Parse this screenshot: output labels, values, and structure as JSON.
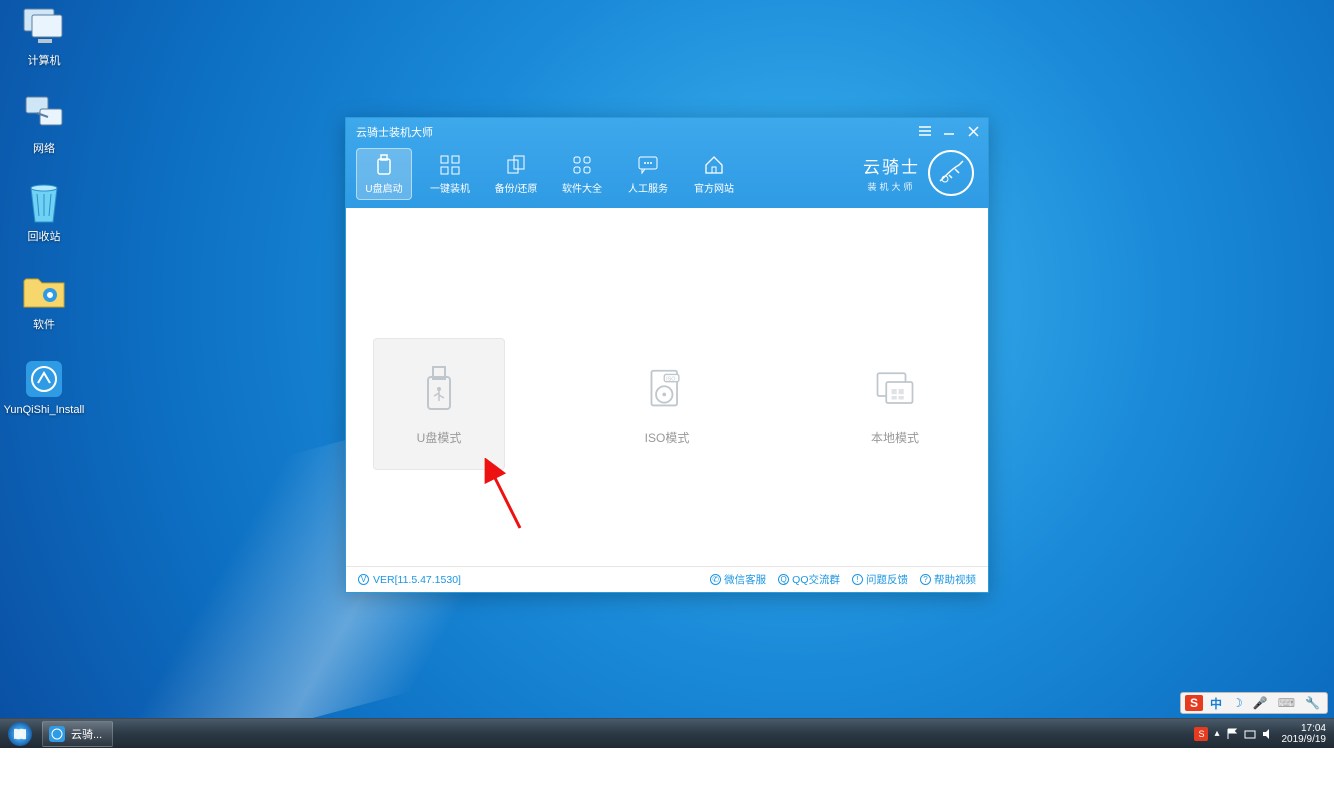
{
  "desktop": {
    "icons": [
      {
        "name": "computer",
        "label": "计算机"
      },
      {
        "name": "network",
        "label": "网络"
      },
      {
        "name": "recycle",
        "label": "回收站"
      },
      {
        "name": "software",
        "label": "软件"
      },
      {
        "name": "yunqishi",
        "label": "YunQiShi_Install"
      }
    ]
  },
  "app": {
    "title": "云骑士装机大师",
    "tabs": [
      {
        "id": "usb-boot",
        "label": "U盘启动",
        "active": true
      },
      {
        "id": "one-key-install",
        "label": "一键装机"
      },
      {
        "id": "backup-restore",
        "label": "备份/还原"
      },
      {
        "id": "software-daquan",
        "label": "软件大全"
      },
      {
        "id": "manual-service",
        "label": "人工服务"
      },
      {
        "id": "official-site",
        "label": "官方网站"
      }
    ],
    "brand": {
      "name": "云骑士",
      "sub": "装机大师"
    },
    "modes": [
      {
        "id": "usb-mode",
        "label": "U盘模式",
        "active": true
      },
      {
        "id": "iso-mode",
        "label": "ISO模式"
      },
      {
        "id": "local-mode",
        "label": "本地模式"
      }
    ],
    "version": "VER[11.5.47.1530]",
    "footerLinks": [
      {
        "id": "wechat-cs",
        "label": "微信客服"
      },
      {
        "id": "qq-group",
        "label": "QQ交流群"
      },
      {
        "id": "feedback",
        "label": "问题反馈"
      },
      {
        "id": "help-video",
        "label": "帮助视频"
      }
    ]
  },
  "ime": {
    "s": "S",
    "lang": "中"
  },
  "taskbar": {
    "app_label": "云骑...",
    "time": "17:04",
    "date": "2019/9/19"
  }
}
